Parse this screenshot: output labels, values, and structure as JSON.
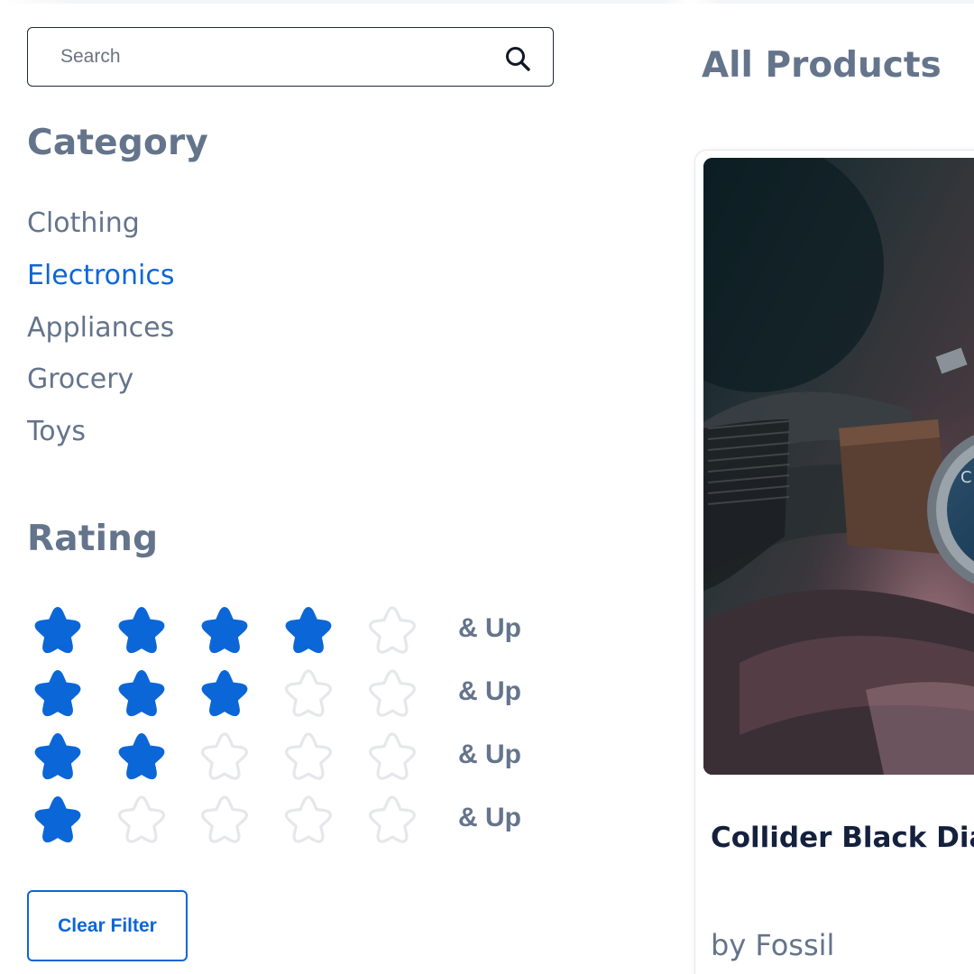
{
  "search": {
    "placeholder": "Search",
    "value": ""
  },
  "sidebar": {
    "category_heading": "Category",
    "categories": [
      {
        "label": "Clothing",
        "active": false
      },
      {
        "label": "Electronics",
        "active": true
      },
      {
        "label": "Appliances",
        "active": false
      },
      {
        "label": "Grocery",
        "active": false
      },
      {
        "label": "Toys",
        "active": false
      }
    ],
    "rating_heading": "Rating",
    "rating_options": [
      {
        "filled": 4,
        "total": 5,
        "label": "& Up"
      },
      {
        "filled": 3,
        "total": 5,
        "label": "& Up"
      },
      {
        "filled": 2,
        "total": 5,
        "label": "& Up"
      },
      {
        "filled": 1,
        "total": 5,
        "label": "& Up"
      }
    ],
    "clear_filter_label": "Clear Filter"
  },
  "main": {
    "title": "All Products",
    "products": [
      {
        "name": "Collider Black Dia",
        "brand": "by Fossil",
        "image_icon": "watch-photo"
      }
    ]
  },
  "colors": {
    "accent": "#0b66d8",
    "muted_text": "#64748b",
    "star_empty": "#e5e7eb",
    "product_name": "#14213d"
  }
}
